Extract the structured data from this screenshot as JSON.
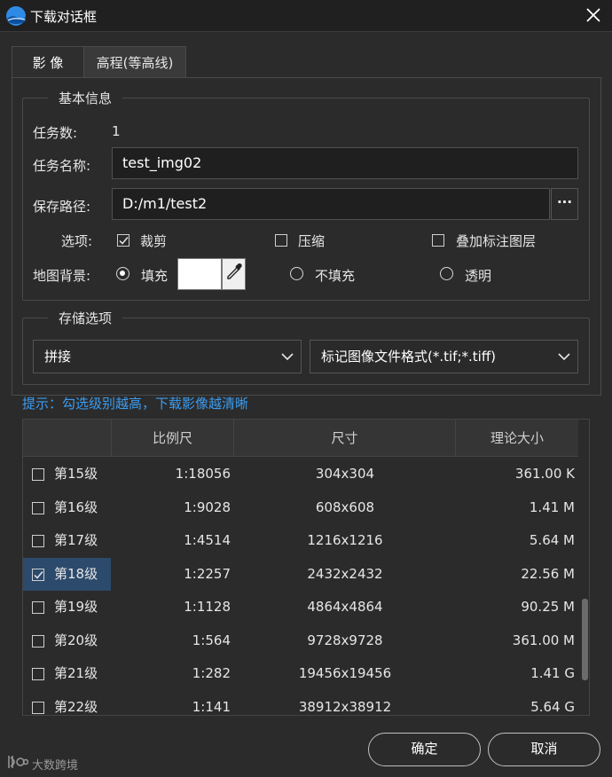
{
  "window": {
    "title": "下载对话框"
  },
  "tabs": [
    {
      "label": "影 像"
    },
    {
      "label": "高程(等高线)"
    }
  ],
  "basic": {
    "title": "基本信息",
    "task_count_label": "任务数:",
    "task_count_value": "1",
    "task_name_label": "任务名称:",
    "task_name_value": "test_img02",
    "save_path_label": "保存路径:",
    "save_path_value": "D:/m1/test2",
    "browse_label": "···",
    "options_label": "选项:",
    "options": [
      {
        "label": "裁剪",
        "checked": true
      },
      {
        "label": "压缩",
        "checked": false
      },
      {
        "label": "叠加标注图层",
        "checked": false
      }
    ],
    "bg_label": "地图背景:",
    "bg_options": [
      {
        "label": "填充",
        "selected": true
      },
      {
        "label": "不填充",
        "selected": false
      },
      {
        "label": "透明",
        "selected": false
      }
    ],
    "fill_color": "#ffffff"
  },
  "storage": {
    "title": "存储选项",
    "mode_value": "拼接",
    "format_value": "标记图像文件格式(*.tif;*.tiff)"
  },
  "hint": "提示：勾选级别越高，下载影像越清晰",
  "table": {
    "headers": [
      "",
      "比例尺",
      "尺寸",
      "理论大小"
    ],
    "rows": [
      {
        "level": "第15级",
        "scale": "1:18056",
        "size": "304x304",
        "est": "361.00 K",
        "checked": false
      },
      {
        "level": "第16级",
        "scale": "1:9028",
        "size": "608x608",
        "est": "1.41 M",
        "checked": false
      },
      {
        "level": "第17级",
        "scale": "1:4514",
        "size": "1216x1216",
        "est": "5.64 M",
        "checked": false
      },
      {
        "level": "第18级",
        "scale": "1:2257",
        "size": "2432x2432",
        "est": "22.56 M",
        "checked": true
      },
      {
        "level": "第19级",
        "scale": "1:1128",
        "size": "4864x4864",
        "est": "90.25 M",
        "checked": false
      },
      {
        "level": "第20级",
        "scale": "1:564",
        "size": "9728x9728",
        "est": "361.00 M",
        "checked": false
      },
      {
        "level": "第21级",
        "scale": "1:282",
        "size": "19456x19456",
        "est": "1.41 G",
        "checked": false
      },
      {
        "level": "第22级",
        "scale": "1:141",
        "size": "38912x38912",
        "est": "5.64 G",
        "checked": false
      }
    ]
  },
  "buttons": {
    "ok": "确定",
    "cancel": "取消"
  },
  "watermark": "大数跨境",
  "colors": {
    "accent": "#3b9cf0",
    "selected_row": "#2c4a6b",
    "background": "#2b2b2b"
  }
}
